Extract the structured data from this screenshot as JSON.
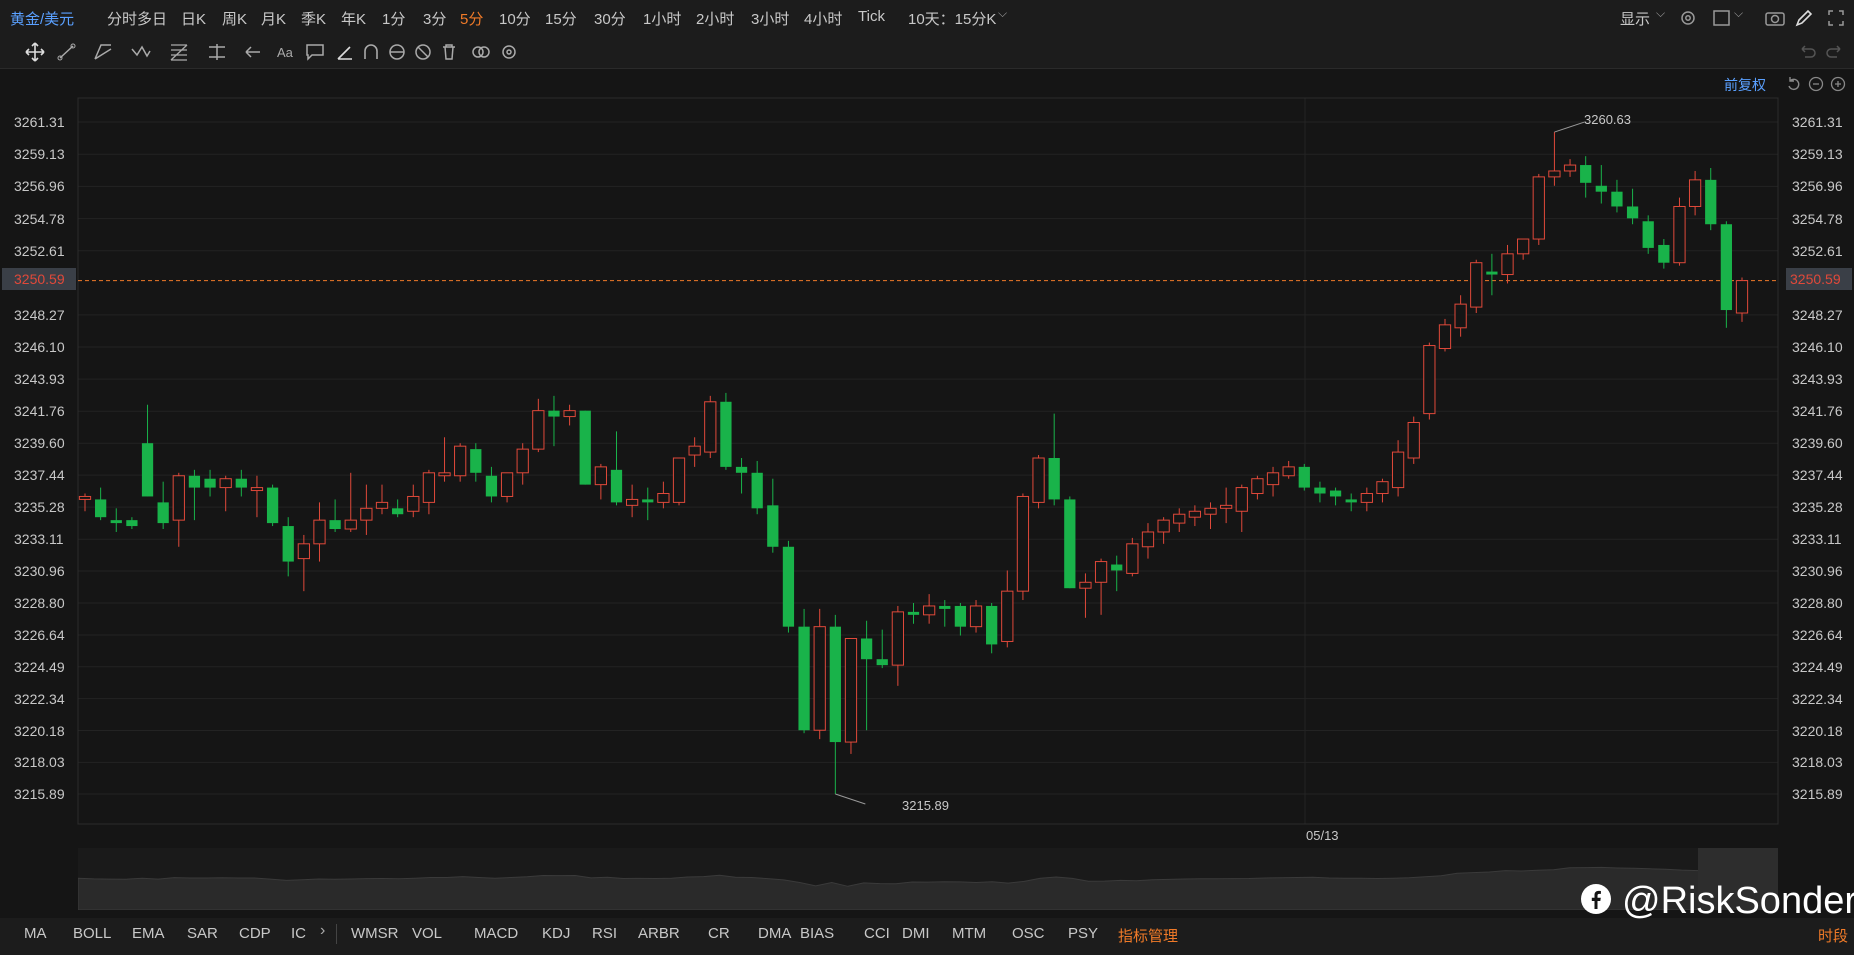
{
  "topbar": {
    "symbol": "黄金/美元",
    "periods": [
      "分时",
      "多日",
      "日K",
      "周K",
      "月K",
      "季K",
      "年K",
      "1分",
      "3分",
      "5分",
      "10分",
      "15分",
      "30分",
      "1小时",
      "2小时",
      "3小时",
      "4小时",
      "Tick"
    ],
    "active_period": "5分",
    "range_selector": "10天：15分K",
    "display_label": "显示"
  },
  "chart_header": {
    "adjust_label": "前复权"
  },
  "price_axis": {
    "ticks": [
      "3261.31",
      "3259.13",
      "3256.96",
      "3254.78",
      "3252.61",
      "3248.27",
      "3246.10",
      "3243.93",
      "3241.76",
      "3239.60",
      "3237.44",
      "3235.28",
      "3233.11",
      "3230.96",
      "3228.80",
      "3226.64",
      "3224.49",
      "3222.34",
      "3220.18",
      "3218.03",
      "3215.89"
    ],
    "current_price": "3250.59"
  },
  "annotations": {
    "high": "3260.63",
    "low": "3215.89"
  },
  "date_label": "05/13",
  "indicators": [
    "MA",
    "BOLL",
    "EMA",
    "SAR",
    "CDP",
    "IC",
    "WMSR",
    "VOL",
    "MACD",
    "KDJ",
    "RSI",
    "ARBR",
    "CR",
    "DMA",
    "BIAS",
    "CCI",
    "DMI",
    "MTM",
    "OSC",
    "PSY"
  ],
  "indicator_manager": "指标管理",
  "period_button": "时段",
  "watermark": "@RiskSonder",
  "colors": {
    "up": "#e0493a",
    "down": "#19b34a",
    "accent": "#f07a28",
    "link": "#5aa0ff"
  },
  "chart_data": {
    "type": "candlestick",
    "y_range": [
      3215.89,
      3261.31
    ],
    "candles": [
      {
        "o": 3235.8,
        "h": 3236.2,
        "l": 3235.0,
        "c": 3236.0
      },
      {
        "o": 3235.8,
        "h": 3236.6,
        "l": 3234.4,
        "c": 3234.6
      },
      {
        "o": 3234.4,
        "h": 3235.2,
        "l": 3233.6,
        "c": 3234.2
      },
      {
        "o": 3234.4,
        "h": 3234.6,
        "l": 3233.8,
        "c": 3234.0
      },
      {
        "o": 3239.6,
        "h": 3242.2,
        "l": 3236.0,
        "c": 3236.0
      },
      {
        "o": 3235.6,
        "h": 3237.0,
        "l": 3233.8,
        "c": 3234.2
      },
      {
        "o": 3234.4,
        "h": 3237.6,
        "l": 3232.6,
        "c": 3237.4
      },
      {
        "o": 3237.4,
        "h": 3237.8,
        "l": 3234.4,
        "c": 3236.6
      },
      {
        "o": 3237.2,
        "h": 3237.8,
        "l": 3236.0,
        "c": 3236.6
      },
      {
        "o": 3236.6,
        "h": 3237.4,
        "l": 3235.0,
        "c": 3237.2
      },
      {
        "o": 3237.2,
        "h": 3237.8,
        "l": 3236.0,
        "c": 3236.6
      },
      {
        "o": 3236.4,
        "h": 3237.4,
        "l": 3234.6,
        "c": 3236.6
      },
      {
        "o": 3236.6,
        "h": 3236.8,
        "l": 3234.0,
        "c": 3234.2
      },
      {
        "o": 3234.0,
        "h": 3234.6,
        "l": 3230.6,
        "c": 3231.6
      },
      {
        "o": 3231.8,
        "h": 3233.4,
        "l": 3229.6,
        "c": 3232.8
      },
      {
        "o": 3232.8,
        "h": 3235.6,
        "l": 3231.6,
        "c": 3234.4
      },
      {
        "o": 3234.4,
        "h": 3235.8,
        "l": 3233.6,
        "c": 3233.8
      },
      {
        "o": 3233.8,
        "h": 3237.6,
        "l": 3233.6,
        "c": 3234.4
      },
      {
        "o": 3234.4,
        "h": 3236.8,
        "l": 3233.4,
        "c": 3235.2
      },
      {
        "o": 3235.2,
        "h": 3236.8,
        "l": 3234.8,
        "c": 3235.6
      },
      {
        "o": 3235.2,
        "h": 3235.8,
        "l": 3234.6,
        "c": 3234.8
      },
      {
        "o": 3235.0,
        "h": 3236.8,
        "l": 3234.6,
        "c": 3236.0
      },
      {
        "o": 3235.6,
        "h": 3237.8,
        "l": 3234.8,
        "c": 3237.6
      },
      {
        "o": 3237.4,
        "h": 3240.0,
        "l": 3237.0,
        "c": 3237.6
      },
      {
        "o": 3237.4,
        "h": 3239.6,
        "l": 3237.0,
        "c": 3239.4
      },
      {
        "o": 3239.2,
        "h": 3239.6,
        "l": 3237.0,
        "c": 3237.6
      },
      {
        "o": 3237.4,
        "h": 3238.0,
        "l": 3235.6,
        "c": 3236.0
      },
      {
        "o": 3236.0,
        "h": 3237.6,
        "l": 3235.6,
        "c": 3237.6
      },
      {
        "o": 3237.6,
        "h": 3239.6,
        "l": 3236.8,
        "c": 3239.2
      },
      {
        "o": 3239.2,
        "h": 3242.6,
        "l": 3239.0,
        "c": 3241.8
      },
      {
        "o": 3241.8,
        "h": 3242.8,
        "l": 3239.4,
        "c": 3241.4
      },
      {
        "o": 3241.4,
        "h": 3242.2,
        "l": 3240.8,
        "c": 3241.8
      },
      {
        "o": 3241.8,
        "h": 3241.8,
        "l": 3236.8,
        "c": 3236.8
      },
      {
        "o": 3236.8,
        "h": 3238.2,
        "l": 3235.8,
        "c": 3238.0
      },
      {
        "o": 3237.8,
        "h": 3240.4,
        "l": 3235.4,
        "c": 3235.6
      },
      {
        "o": 3235.4,
        "h": 3236.8,
        "l": 3234.6,
        "c": 3235.8
      },
      {
        "o": 3235.8,
        "h": 3236.6,
        "l": 3234.4,
        "c": 3235.6
      },
      {
        "o": 3235.6,
        "h": 3237.0,
        "l": 3235.2,
        "c": 3236.2
      },
      {
        "o": 3235.6,
        "h": 3238.6,
        "l": 3235.4,
        "c": 3238.6
      },
      {
        "o": 3238.8,
        "h": 3240.0,
        "l": 3238.0,
        "c": 3239.4
      },
      {
        "o": 3239.0,
        "h": 3242.8,
        "l": 3238.6,
        "c": 3242.4
      },
      {
        "o": 3242.4,
        "h": 3243.0,
        "l": 3237.8,
        "c": 3238.0
      },
      {
        "o": 3238.0,
        "h": 3238.6,
        "l": 3236.2,
        "c": 3237.6
      },
      {
        "o": 3237.6,
        "h": 3238.4,
        "l": 3234.8,
        "c": 3235.2
      },
      {
        "o": 3235.4,
        "h": 3237.2,
        "l": 3232.2,
        "c": 3232.6
      },
      {
        "o": 3232.6,
        "h": 3233.0,
        "l": 3226.8,
        "c": 3227.2
      },
      {
        "o": 3227.2,
        "h": 3228.4,
        "l": 3220.0,
        "c": 3220.2
      },
      {
        "o": 3220.2,
        "h": 3228.4,
        "l": 3219.6,
        "c": 3227.2
      },
      {
        "o": 3227.2,
        "h": 3228.0,
        "l": 3215.89,
        "c": 3219.4
      },
      {
        "o": 3219.4,
        "h": 3226.4,
        "l": 3218.6,
        "c": 3226.4
      },
      {
        "o": 3226.4,
        "h": 3227.6,
        "l": 3220.2,
        "c": 3225.0
      },
      {
        "o": 3225.0,
        "h": 3227.0,
        "l": 3224.4,
        "c": 3224.6
      },
      {
        "o": 3224.6,
        "h": 3228.6,
        "l": 3223.2,
        "c": 3228.2
      },
      {
        "o": 3228.2,
        "h": 3228.8,
        "l": 3227.4,
        "c": 3228.0
      },
      {
        "o": 3228.0,
        "h": 3229.4,
        "l": 3227.4,
        "c": 3228.6
      },
      {
        "o": 3228.6,
        "h": 3229.0,
        "l": 3227.2,
        "c": 3228.4
      },
      {
        "o": 3228.6,
        "h": 3228.8,
        "l": 3226.6,
        "c": 3227.2
      },
      {
        "o": 3227.2,
        "h": 3229.0,
        "l": 3226.8,
        "c": 3228.6
      },
      {
        "o": 3228.6,
        "h": 3228.8,
        "l": 3225.4,
        "c": 3226.0
      },
      {
        "o": 3226.2,
        "h": 3231.0,
        "l": 3225.8,
        "c": 3229.6
      },
      {
        "o": 3229.6,
        "h": 3236.2,
        "l": 3229.0,
        "c": 3236.0
      },
      {
        "o": 3235.6,
        "h": 3238.8,
        "l": 3235.2,
        "c": 3238.6
      },
      {
        "o": 3238.6,
        "h": 3241.6,
        "l": 3235.4,
        "c": 3235.8
      },
      {
        "o": 3235.8,
        "h": 3236.0,
        "l": 3229.8,
        "c": 3229.8
      },
      {
        "o": 3229.8,
        "h": 3230.8,
        "l": 3227.8,
        "c": 3230.2
      },
      {
        "o": 3230.2,
        "h": 3231.8,
        "l": 3228.0,
        "c": 3231.6
      },
      {
        "o": 3231.4,
        "h": 3232.0,
        "l": 3229.6,
        "c": 3231.0
      },
      {
        "o": 3230.8,
        "h": 3233.2,
        "l": 3230.6,
        "c": 3232.8
      },
      {
        "o": 3232.6,
        "h": 3234.2,
        "l": 3231.8,
        "c": 3233.6
      },
      {
        "o": 3233.6,
        "h": 3234.6,
        "l": 3232.8,
        "c": 3234.4
      },
      {
        "o": 3234.2,
        "h": 3235.2,
        "l": 3233.6,
        "c": 3234.8
      },
      {
        "o": 3234.6,
        "h": 3235.4,
        "l": 3234.0,
        "c": 3235.0
      },
      {
        "o": 3234.8,
        "h": 3235.6,
        "l": 3233.8,
        "c": 3235.2
      },
      {
        "o": 3235.2,
        "h": 3236.6,
        "l": 3234.2,
        "c": 3235.4
      },
      {
        "o": 3235.0,
        "h": 3236.8,
        "l": 3233.6,
        "c": 3236.6
      },
      {
        "o": 3236.2,
        "h": 3237.4,
        "l": 3235.8,
        "c": 3237.2
      },
      {
        "o": 3236.8,
        "h": 3238.0,
        "l": 3236.0,
        "c": 3237.6
      },
      {
        "o": 3237.4,
        "h": 3238.4,
        "l": 3237.2,
        "c": 3238.0
      },
      {
        "o": 3238.0,
        "h": 3238.2,
        "l": 3236.4,
        "c": 3236.6
      },
      {
        "o": 3236.6,
        "h": 3237.0,
        "l": 3235.6,
        "c": 3236.2
      },
      {
        "o": 3236.4,
        "h": 3236.6,
        "l": 3235.4,
        "c": 3236.0
      },
      {
        "o": 3235.8,
        "h": 3236.2,
        "l": 3235.0,
        "c": 3235.6
      },
      {
        "o": 3235.6,
        "h": 3236.6,
        "l": 3235.0,
        "c": 3236.2
      },
      {
        "o": 3236.2,
        "h": 3237.2,
        "l": 3235.6,
        "c": 3237.0
      },
      {
        "o": 3236.6,
        "h": 3239.8,
        "l": 3236.0,
        "c": 3239.0
      },
      {
        "o": 3238.6,
        "h": 3241.4,
        "l": 3238.2,
        "c": 3241.0
      },
      {
        "o": 3241.6,
        "h": 3246.4,
        "l": 3241.2,
        "c": 3246.2
      },
      {
        "o": 3246.0,
        "h": 3248.0,
        "l": 3245.8,
        "c": 3247.6
      },
      {
        "o": 3247.4,
        "h": 3249.6,
        "l": 3246.8,
        "c": 3249.0
      },
      {
        "o": 3248.8,
        "h": 3252.0,
        "l": 3248.4,
        "c": 3251.8
      },
      {
        "o": 3251.2,
        "h": 3252.4,
        "l": 3249.6,
        "c": 3251.0
      },
      {
        "o": 3251.0,
        "h": 3253.0,
        "l": 3250.4,
        "c": 3252.4
      },
      {
        "o": 3252.4,
        "h": 3253.4,
        "l": 3252.0,
        "c": 3253.4
      },
      {
        "o": 3253.4,
        "h": 3257.8,
        "l": 3253.0,
        "c": 3257.6
      },
      {
        "o": 3257.6,
        "h": 3260.63,
        "l": 3257.0,
        "c": 3258.0
      },
      {
        "o": 3258.0,
        "h": 3258.8,
        "l": 3257.6,
        "c": 3258.4
      },
      {
        "o": 3258.4,
        "h": 3259.0,
        "l": 3256.2,
        "c": 3257.2
      },
      {
        "o": 3257.0,
        "h": 3258.4,
        "l": 3255.8,
        "c": 3256.6
      },
      {
        "o": 3256.6,
        "h": 3257.4,
        "l": 3255.2,
        "c": 3255.6
      },
      {
        "o": 3255.6,
        "h": 3256.8,
        "l": 3254.4,
        "c": 3254.8
      },
      {
        "o": 3254.6,
        "h": 3255.0,
        "l": 3252.4,
        "c": 3252.8
      },
      {
        "o": 3253.0,
        "h": 3253.4,
        "l": 3251.4,
        "c": 3251.8
      },
      {
        "o": 3251.8,
        "h": 3256.2,
        "l": 3251.6,
        "c": 3255.6
      },
      {
        "o": 3255.6,
        "h": 3258.0,
        "l": 3255.0,
        "c": 3257.4
      },
      {
        "o": 3257.4,
        "h": 3258.2,
        "l": 3254.0,
        "c": 3254.4
      },
      {
        "o": 3254.4,
        "h": 3254.6,
        "l": 3247.4,
        "c": 3248.6
      },
      {
        "o": 3248.4,
        "h": 3250.8,
        "l": 3247.8,
        "c": 3250.59
      }
    ]
  }
}
